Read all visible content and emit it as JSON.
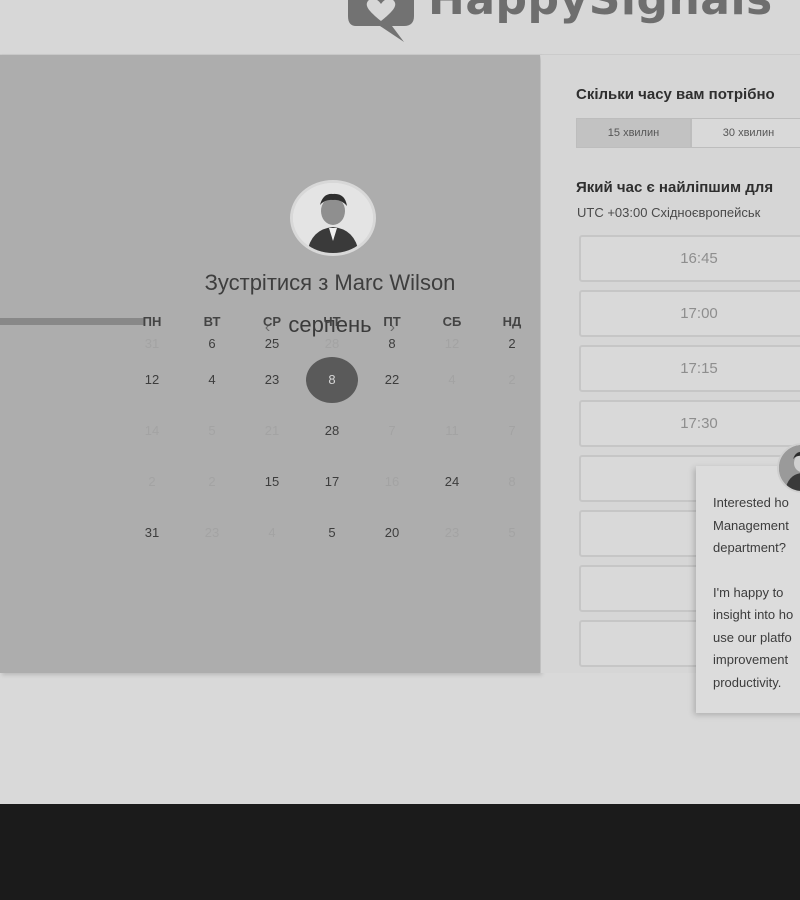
{
  "header": {
    "brand": "HappySignals"
  },
  "meeting": {
    "title": "Зустрітися з Marc Wilson",
    "month": "серпень",
    "prev_icon": "‹",
    "next_icon": "›"
  },
  "calendar": {
    "weekdays": [
      "ПН",
      "ВТ",
      "СР",
      "ЧТ",
      "ПТ",
      "СБ",
      "НД"
    ],
    "rows": [
      [
        {
          "d": "31",
          "m": 1
        },
        {
          "d": "6",
          "m": 0
        },
        {
          "d": "25",
          "m": 0
        },
        {
          "d": "28",
          "m": 1
        },
        {
          "d": "8",
          "m": 0
        },
        {
          "d": "12",
          "m": 1
        },
        {
          "d": "2",
          "m": 0
        }
      ],
      [
        {
          "d": "12",
          "m": 0
        },
        {
          "d": "4",
          "m": 0
        },
        {
          "d": "23",
          "m": 0
        },
        {
          "d": "8",
          "m": 0,
          "s": 1
        },
        {
          "d": "22",
          "m": 0
        },
        {
          "d": "4",
          "m": 1
        },
        {
          "d": "2",
          "m": 1
        }
      ],
      [
        {
          "d": "14",
          "m": 1
        },
        {
          "d": "5",
          "m": 1
        },
        {
          "d": "21",
          "m": 1
        },
        {
          "d": "28",
          "m": 0
        },
        {
          "d": "7",
          "m": 1
        },
        {
          "d": "11",
          "m": 1
        },
        {
          "d": "7",
          "m": 1
        }
      ],
      [
        {
          "d": "2",
          "m": 1
        },
        {
          "d": "2",
          "m": 1
        },
        {
          "d": "15",
          "m": 0
        },
        {
          "d": "17",
          "m": 0
        },
        {
          "d": "16",
          "m": 1
        },
        {
          "d": "24",
          "m": 0
        },
        {
          "d": "8",
          "m": 1
        }
      ],
      [
        {
          "d": "31",
          "m": 0
        },
        {
          "d": "23",
          "m": 1
        },
        {
          "d": "4",
          "m": 1
        },
        {
          "d": "5",
          "m": 0
        },
        {
          "d": "20",
          "m": 0
        },
        {
          "d": "23",
          "m": 1
        },
        {
          "d": "5",
          "m": 1
        }
      ]
    ]
  },
  "booking": {
    "duration_question": "Скільки часу вам потрібно",
    "durations": [
      "15 хвилин",
      "30 хвилин"
    ],
    "time_question": "Який час є найліпшим для",
    "timezone": "UTC +03:00 Східноєвропейськ",
    "slots": [
      "16:45",
      "17:00",
      "17:15",
      "17:30",
      "",
      "",
      "",
      ""
    ]
  },
  "chat": {
    "line1": "Interested ho",
    "line2": "Management",
    "line3": "department?",
    "line4": "I'm happy to",
    "line5": "insight into ho",
    "line6": "use our platfo",
    "line7": "improvement",
    "line8": "productivity."
  },
  "colors": {
    "selected_day": "#5a5a5a",
    "left_panel": "#adadad",
    "footer": "#1b1b1b"
  }
}
